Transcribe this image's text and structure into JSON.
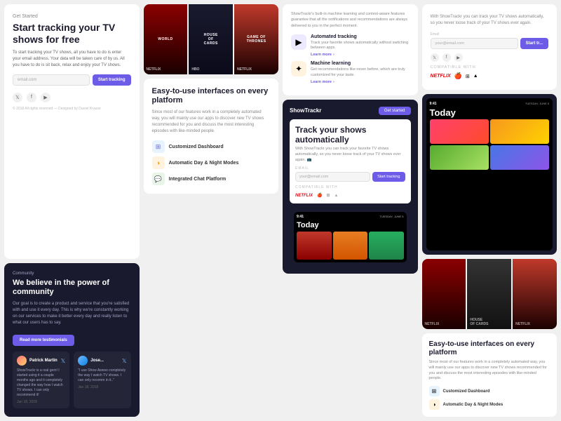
{
  "app": {
    "name": "ShowTrackr",
    "tagline": "Track your shows automatically"
  },
  "col1": {
    "getStarted": "Get Started",
    "heroTitle": "Start tracking your TV shows for free",
    "heroDesc": "To start tracking your TV shows, all you have to do is enter your email address. Your data will be taken care of by us. All you have to do is sit back, relax and enjoy your TV shows.",
    "emailPlaceholder": "email.com",
    "ctaButton": "Start tracking",
    "social": {
      "twitter": "𝕏",
      "facebook": "f",
      "youtube": "▶"
    },
    "footer": "© 2018 All rights reserved — Designed by Daniel Krause",
    "community": {
      "tag": "Community",
      "title": "We believe in the power of community",
      "desc": "Our goal is to create a product and service that you're satisfied with and use it every day. This is why we're constantly working on our services to make it better every day and really listen to what our users has to say.",
      "cta": "Read more testimonials"
    },
    "testimonials": [
      {
        "name": "Patrick Martin",
        "text": "ShowTrackr is a real gem! I started using it a couple months ago and it completely changed the way how I watch TV shows. I can only recommend it!",
        "date": "Jan 18, 2018"
      },
      {
        "name": "Jose...",
        "text": "\"I use Show Aweso completely the way I watch TV shows. I can only recomm in it..\"",
        "date": "Jan 18, 2018"
      }
    ]
  },
  "col2": {
    "shows": [
      {
        "label": "NETFLIX",
        "title": "WORLD",
        "bg": "netflix"
      },
      {
        "label": "HBO",
        "title": "HOUSE OF CARDS",
        "bg": "hbo"
      },
      {
        "label": "NETFLIX",
        "title": "GAME OF THRONES",
        "bg": "netflix2"
      }
    ],
    "platformsTitle": "Easy-to-use interfaces on every platform",
    "platformsDesc": "Since most of our features work in a completely automated way, you will mainly use our apps to discover new TV shows recommended for you and discuss the most interesting episodes with like-minded people.",
    "features": [
      {
        "icon": "⊞",
        "label": "Customized Dashboard",
        "color": "blue"
      },
      {
        "icon": "◑",
        "label": "Automatic Day & Night Modes",
        "color": "orange"
      },
      {
        "icon": "💬",
        "label": "Integrated Chat Platform",
        "color": "green"
      }
    ]
  },
  "col3": {
    "trackingBuiltIn": "ShowTrackr's built-in machine learning and context-aware features guarantee that all the notifications and recommendations are always delivered to you in the perfect moment.",
    "features": [
      {
        "title": "Automated tracking",
        "desc": "Track your favorite shows automatically without switching between apps.",
        "learnMore": "Learn more",
        "icon": "▶",
        "iconBg": "purple"
      },
      {
        "title": "Machine learning",
        "desc": "Get recommendations like never before, which are truly customized for your taste.",
        "learnMore": "Learn more",
        "icon": "✦",
        "iconBg": "orange"
      }
    ],
    "mobile": {
      "logoText": "ShowTrackr",
      "ctaBtn": "Get started",
      "heroTitle": "Track your shows automatically",
      "heroDesc": "With ShowTrackr you can track your favorite TV shows automatically, so you never loose track of your TV shows ever again. 📺",
      "emailPlaceholder": "your@email.com",
      "ctaButton": "Start tracking",
      "compatText": "COMPATIBLE WITH",
      "partners": [
        "NETFLIX",
        "🍎",
        "⊞",
        "▲"
      ]
    },
    "phone": {
      "time": "9:41",
      "dateLabel": "TUESDAY, JUNE 5",
      "today": "Today",
      "shows": [
        "s1",
        "s2",
        "s3"
      ]
    }
  },
  "col4": {
    "heroDesc": "With ShowTrackr you can track your TV shows automatically, so you never loose track of your TV shows ever again.",
    "emailLabel": "Email",
    "emailPlaceholder": "your@email.com",
    "ctaButton": "Start tr...",
    "social": {
      "twitter": "𝕏",
      "facebook": "f",
      "youtube": "▶"
    },
    "compatText": "COMPATIBLE WITH",
    "partners": [
      "NETFLIX",
      "🍎",
      "⊞",
      "▲"
    ],
    "phone": {
      "time": "9:41",
      "dateLabel": "TUESDAY, JUNE 5",
      "today": "Today",
      "thumbs": [
        "t1",
        "t2",
        "t3",
        "t4"
      ]
    },
    "shows": [
      {
        "label": "NETFLIX",
        "bg": "n1"
      },
      {
        "label": "",
        "bg": "n2"
      },
      {
        "label": "NETFLIX",
        "bg": "n3"
      }
    ],
    "platformsTitle": "Easy-to-use interfaces on every platform",
    "platformsDesc": "Since most of our features work in a completely automated way, you will mainly use our apps to discover new TV shows recommended for you and discuss the most interesting episodes with like-minded people.",
    "features": [
      {
        "icon": "⊞",
        "label": "Customized Dashboard",
        "color": "blue"
      },
      {
        "icon": "◑",
        "label": "Automatic Day & Night Modes",
        "color": "orange"
      }
    ]
  }
}
